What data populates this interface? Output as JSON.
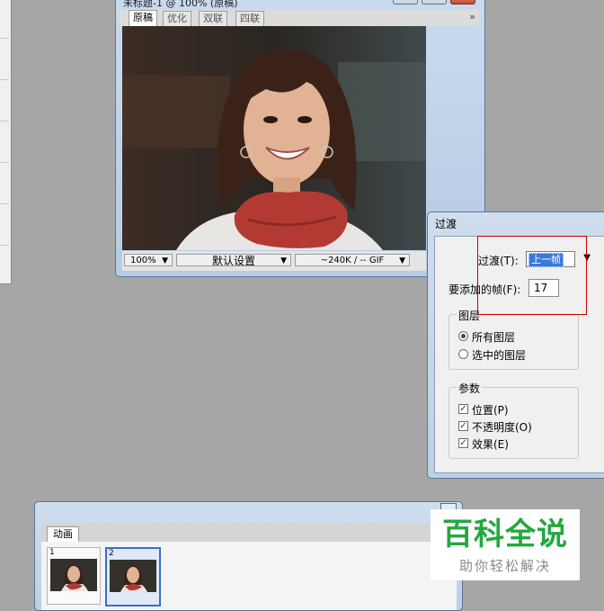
{
  "image_window": {
    "title": "未标题-1 @ 100% (原稿)",
    "tabs": [
      "原稿",
      "优化",
      "双联",
      "四联"
    ],
    "active_tab": "原稿",
    "more_tabs": "»",
    "status": {
      "zoom": "100%",
      "preset": "默认设置",
      "size_info": "~240K / -- GIF"
    }
  },
  "dialog": {
    "title": "过渡",
    "method_label": "过渡(T):",
    "method_value": "上一帧",
    "frames_label": "要添加的帧(F):",
    "frames_value": "17",
    "layers_group": {
      "title": "图层",
      "options": [
        "所有图层",
        "选中的图层"
      ],
      "selected_index": 0
    },
    "params_group": {
      "title": "参数",
      "options": [
        "位置(P)",
        "不透明度(O)",
        "效果(E)"
      ],
      "checked": [
        true,
        true,
        true
      ]
    }
  },
  "animation_panel": {
    "tab": "动画",
    "frames": [
      {
        "number": "1",
        "selected": false
      },
      {
        "number": "2",
        "selected": true
      }
    ]
  },
  "watermark": {
    "main": "百科全说",
    "sub": "助你轻松解决"
  },
  "colors": {
    "highlight_box": "#c40000",
    "selection": "#3a78d8",
    "watermark_green": "#22a940"
  }
}
